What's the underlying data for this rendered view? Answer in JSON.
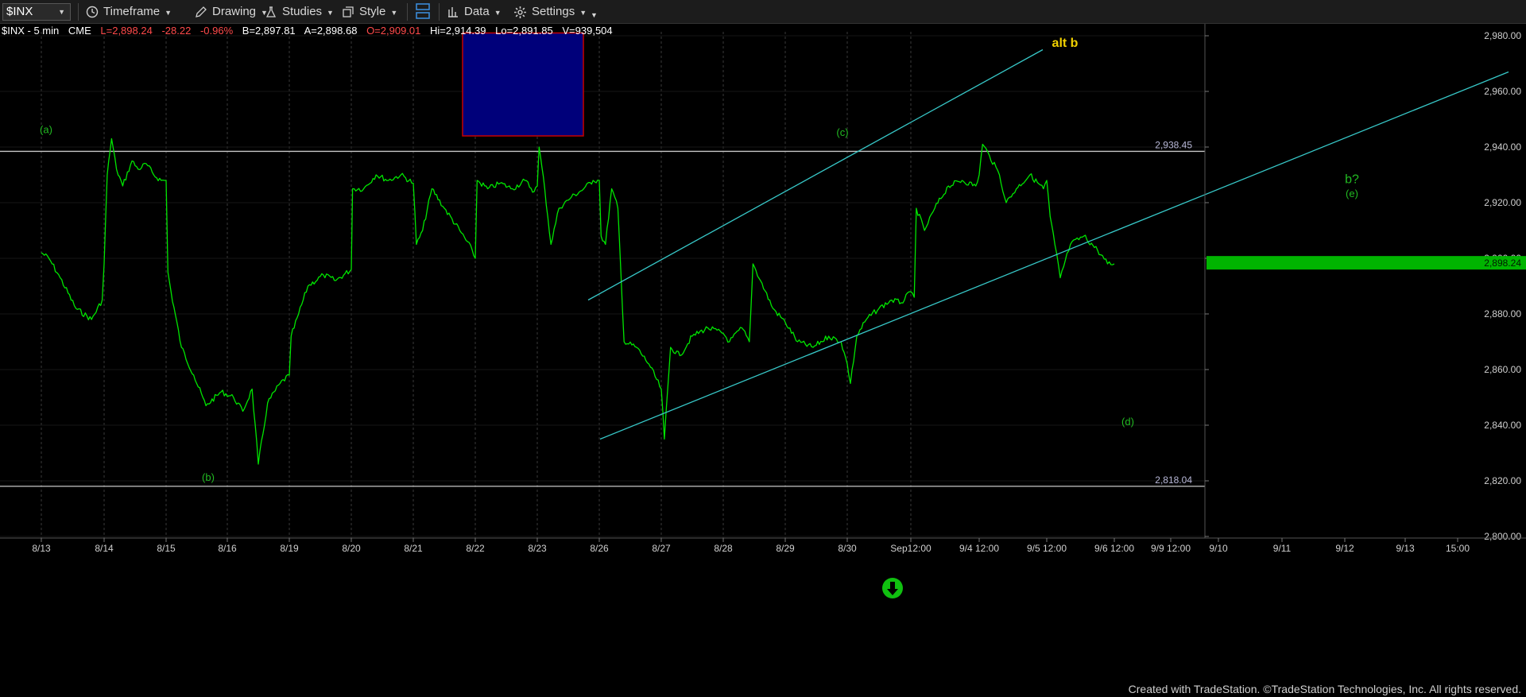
{
  "toolbar": {
    "symbol": "$INX",
    "timeframe": "Timeframe",
    "drawing": "Drawing",
    "studies": "Studies",
    "style": "Style",
    "data": "Data",
    "settings": "Settings"
  },
  "info": {
    "symbol": "$INX - 5 min",
    "exchange": "CME",
    "last": "L=2,898.24",
    "change": "-28.22",
    "pct": "-0.96%",
    "bid": "B=2,897.81",
    "ask": "A=2,898.68",
    "open": "O=2,909.01",
    "high": "Hi=2,914.39",
    "low": "Lo=2,891.85",
    "volume": "V=939,504"
  },
  "colors": {
    "price": "#00e600",
    "channel": "#37c8c8",
    "hline": "#c8c8c8",
    "box_fill": "#00007a",
    "box_border": "#c80000",
    "label_green": "#22bb22",
    "alt_label": "#f0d000",
    "last_price_bg": "#00b400",
    "down_arrow": "#10c010"
  },
  "footer": "Created with TradeStation. ©TradeStation Technologies, Inc. All rights reserved.",
  "chart_data": {
    "type": "line",
    "title": "$INX - 5 min",
    "y_axis": {
      "range": [
        2795,
        2983
      ],
      "ticks": [
        2800,
        2820,
        2840,
        2860,
        2880,
        2900,
        2920,
        2940,
        2960,
        2980
      ],
      "tick_labels": [
        "2,800.00",
        "2,820.00",
        "2,840.00",
        "2,860.00",
        "2,880.00",
        "2,900.00",
        "2,920.00",
        "2,940.00",
        "2,960.00",
        "2,980.00"
      ],
      "position": "right"
    },
    "x_axis": {
      "labels": [
        "8/13",
        "8/14",
        "8/15",
        "8/16",
        "8/19",
        "8/20",
        "8/21",
        "8/22",
        "8/23",
        "8/26",
        "8/27",
        "8/28",
        "8/29",
        "8/30",
        "Sep12:00",
        "9/4 12:00",
        "9/5 12:00",
        "9/6 12:00",
        "9/9 12:00",
        "9/10",
        "9/11",
        "9/12",
        "9/13",
        "15:00"
      ],
      "session_lines": [
        "8/13",
        "8/14",
        "8/15",
        "8/16",
        "8/19",
        "8/20",
        "8/21",
        "8/22",
        "8/23",
        "8/26",
        "8/27",
        "8/28",
        "8/29",
        "8/30",
        "Sep12:00"
      ]
    },
    "series": [
      {
        "values": [
          [
            0.0,
            2902
          ],
          [
            0.12,
            2900
          ],
          [
            0.3,
            2893
          ],
          [
            0.55,
            2882
          ],
          [
            0.8,
            2878
          ],
          [
            0.97,
            2885
          ],
          [
            1.0,
            2898
          ],
          [
            1.05,
            2930
          ],
          [
            1.12,
            2943
          ],
          [
            1.2,
            2932
          ],
          [
            1.3,
            2926
          ],
          [
            1.45,
            2935
          ],
          [
            1.55,
            2932
          ],
          [
            1.68,
            2934
          ],
          [
            1.8,
            2930
          ],
          [
            1.92,
            2928
          ],
          [
            2.0,
            2928
          ],
          [
            2.03,
            2895
          ],
          [
            2.08,
            2888
          ],
          [
            2.25,
            2868
          ],
          [
            2.45,
            2858
          ],
          [
            2.65,
            2847
          ],
          [
            2.9,
            2852
          ],
          [
            3.1,
            2850
          ],
          [
            3.25,
            2845
          ],
          [
            3.4,
            2853
          ],
          [
            3.5,
            2826
          ],
          [
            3.65,
            2848
          ],
          [
            3.85,
            2855
          ],
          [
            4.0,
            2858
          ],
          [
            4.03,
            2872
          ],
          [
            4.15,
            2880
          ],
          [
            4.3,
            2890
          ],
          [
            4.55,
            2894
          ],
          [
            4.75,
            2892
          ],
          [
            5.0,
            2896
          ],
          [
            5.02,
            2925
          ],
          [
            5.2,
            2925
          ],
          [
            5.4,
            2930
          ],
          [
            5.6,
            2928
          ],
          [
            5.8,
            2930
          ],
          [
            6.0,
            2927
          ],
          [
            6.05,
            2905
          ],
          [
            6.15,
            2910
          ],
          [
            6.3,
            2925
          ],
          [
            6.5,
            2918
          ],
          [
            6.75,
            2910
          ],
          [
            6.95,
            2903
          ],
          [
            7.0,
            2900
          ],
          [
            7.03,
            2928
          ],
          [
            7.2,
            2925
          ],
          [
            7.4,
            2927
          ],
          [
            7.6,
            2925
          ],
          [
            7.8,
            2928
          ],
          [
            7.95,
            2924
          ],
          [
            8.0,
            2926
          ],
          [
            8.03,
            2940
          ],
          [
            8.12,
            2925
          ],
          [
            8.22,
            2905
          ],
          [
            8.35,
            2918
          ],
          [
            8.55,
            2922
          ],
          [
            8.75,
            2925
          ],
          [
            8.9,
            2928
          ],
          [
            9.0,
            2928
          ],
          [
            9.03,
            2908
          ],
          [
            9.1,
            2905
          ],
          [
            9.2,
            2925
          ],
          [
            9.3,
            2918
          ],
          [
            9.4,
            2870
          ],
          [
            9.6,
            2868
          ],
          [
            9.8,
            2862
          ],
          [
            10.0,
            2853
          ],
          [
            10.05,
            2835
          ],
          [
            10.15,
            2868
          ],
          [
            10.3,
            2865
          ],
          [
            10.5,
            2872
          ],
          [
            10.75,
            2875
          ],
          [
            11.0,
            2873
          ],
          [
            11.1,
            2870
          ],
          [
            11.3,
            2875
          ],
          [
            11.42,
            2870
          ],
          [
            11.48,
            2898
          ],
          [
            11.6,
            2892
          ],
          [
            11.8,
            2882
          ],
          [
            12.0,
            2877
          ],
          [
            12.2,
            2870
          ],
          [
            12.45,
            2868
          ],
          [
            12.7,
            2872
          ],
          [
            12.9,
            2870
          ],
          [
            13.0,
            2862
          ],
          [
            13.05,
            2855
          ],
          [
            13.15,
            2872
          ],
          [
            13.3,
            2878
          ],
          [
            13.5,
            2882
          ],
          [
            13.7,
            2885
          ],
          [
            13.85,
            2884
          ],
          [
            14.0,
            2888
          ],
          [
            14.05,
            2886
          ],
          [
            14.08,
            2918
          ],
          [
            14.2,
            2910
          ],
          [
            14.35,
            2918
          ],
          [
            14.55,
            2926
          ],
          [
            14.75,
            2928
          ],
          [
            14.95,
            2926
          ],
          [
            15.0,
            2930
          ],
          [
            15.05,
            2941
          ],
          [
            15.15,
            2937
          ],
          [
            15.3,
            2930
          ],
          [
            15.4,
            2920
          ],
          [
            15.55,
            2925
          ],
          [
            15.75,
            2930
          ],
          [
            15.95,
            2925
          ],
          [
            16.0,
            2928
          ],
          [
            16.05,
            2915
          ],
          [
            16.12,
            2905
          ],
          [
            16.2,
            2893
          ],
          [
            16.35,
            2905
          ],
          [
            16.55,
            2908
          ],
          [
            16.75,
            2903
          ],
          [
            16.9,
            2898
          ],
          [
            17.0,
            2898
          ]
        ]
      }
    ],
    "horizontal_lines": [
      {
        "value": 2938.45,
        "label": "2,938.45"
      },
      {
        "value": 2818.04,
        "label": "2,818.04"
      }
    ],
    "channel_lines": [
      {
        "from": [
          "8/26",
          2885
        ],
        "to": [
          "9/4",
          2975
        ]
      },
      {
        "from": [
          "8/26",
          2835
        ],
        "to": [
          "9/13",
          2967
        ]
      }
    ],
    "box": {
      "from": [
        "8/22",
        2981
      ],
      "to": [
        "8/23",
        2944
      ]
    },
    "last_price_label": "2,898.24",
    "annotations": [
      {
        "text": "(a)",
        "at": [
          "8/13",
          2945
        ]
      },
      {
        "text": "(b)",
        "at": [
          "8/15",
          2820
        ]
      },
      {
        "text": "(c)",
        "at": [
          "8/30",
          2944
        ]
      },
      {
        "text": "(d)",
        "at": [
          "9/6 12:00",
          2840
        ]
      },
      {
        "text": "(e)",
        "at": [
          "9/12",
          2922
        ]
      },
      {
        "text": "b?",
        "at": [
          "9/12",
          2927
        ]
      },
      {
        "text": "alt b",
        "at": [
          "9/4 12:00",
          2976
        ]
      }
    ]
  }
}
